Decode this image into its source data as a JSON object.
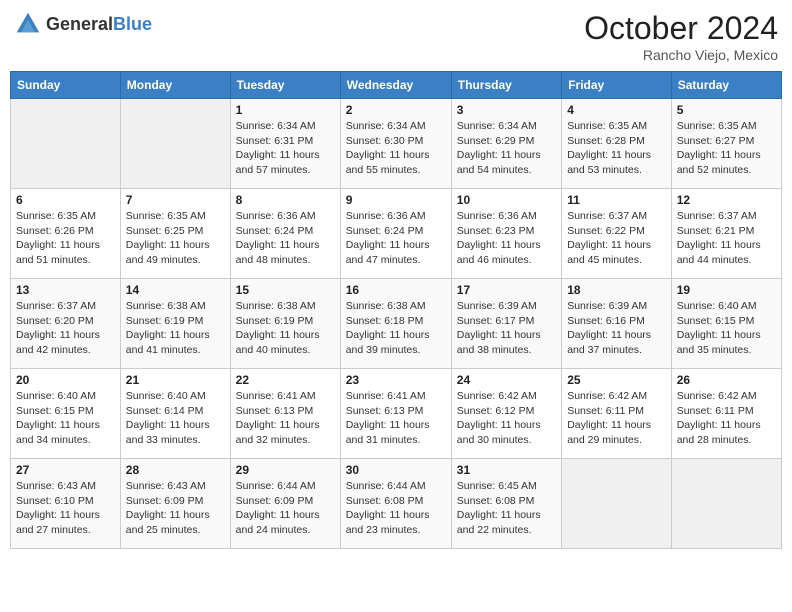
{
  "header": {
    "logo_general": "General",
    "logo_blue": "Blue",
    "month_year": "October 2024",
    "location": "Rancho Viejo, Mexico"
  },
  "days_of_week": [
    "Sunday",
    "Monday",
    "Tuesday",
    "Wednesday",
    "Thursday",
    "Friday",
    "Saturday"
  ],
  "weeks": [
    [
      {
        "day": "",
        "empty": true
      },
      {
        "day": "",
        "empty": true
      },
      {
        "day": "1",
        "sunrise": "6:34 AM",
        "sunset": "6:31 PM",
        "daylight": "11 hours and 57 minutes."
      },
      {
        "day": "2",
        "sunrise": "6:34 AM",
        "sunset": "6:30 PM",
        "daylight": "11 hours and 55 minutes."
      },
      {
        "day": "3",
        "sunrise": "6:34 AM",
        "sunset": "6:29 PM",
        "daylight": "11 hours and 54 minutes."
      },
      {
        "day": "4",
        "sunrise": "6:35 AM",
        "sunset": "6:28 PM",
        "daylight": "11 hours and 53 minutes."
      },
      {
        "day": "5",
        "sunrise": "6:35 AM",
        "sunset": "6:27 PM",
        "daylight": "11 hours and 52 minutes."
      }
    ],
    [
      {
        "day": "6",
        "sunrise": "6:35 AM",
        "sunset": "6:26 PM",
        "daylight": "11 hours and 51 minutes."
      },
      {
        "day": "7",
        "sunrise": "6:35 AM",
        "sunset": "6:25 PM",
        "daylight": "11 hours and 49 minutes."
      },
      {
        "day": "8",
        "sunrise": "6:36 AM",
        "sunset": "6:24 PM",
        "daylight": "11 hours and 48 minutes."
      },
      {
        "day": "9",
        "sunrise": "6:36 AM",
        "sunset": "6:24 PM",
        "daylight": "11 hours and 47 minutes."
      },
      {
        "day": "10",
        "sunrise": "6:36 AM",
        "sunset": "6:23 PM",
        "daylight": "11 hours and 46 minutes."
      },
      {
        "day": "11",
        "sunrise": "6:37 AM",
        "sunset": "6:22 PM",
        "daylight": "11 hours and 45 minutes."
      },
      {
        "day": "12",
        "sunrise": "6:37 AM",
        "sunset": "6:21 PM",
        "daylight": "11 hours and 44 minutes."
      }
    ],
    [
      {
        "day": "13",
        "sunrise": "6:37 AM",
        "sunset": "6:20 PM",
        "daylight": "11 hours and 42 minutes."
      },
      {
        "day": "14",
        "sunrise": "6:38 AM",
        "sunset": "6:19 PM",
        "daylight": "11 hours and 41 minutes."
      },
      {
        "day": "15",
        "sunrise": "6:38 AM",
        "sunset": "6:19 PM",
        "daylight": "11 hours and 40 minutes."
      },
      {
        "day": "16",
        "sunrise": "6:38 AM",
        "sunset": "6:18 PM",
        "daylight": "11 hours and 39 minutes."
      },
      {
        "day": "17",
        "sunrise": "6:39 AM",
        "sunset": "6:17 PM",
        "daylight": "11 hours and 38 minutes."
      },
      {
        "day": "18",
        "sunrise": "6:39 AM",
        "sunset": "6:16 PM",
        "daylight": "11 hours and 37 minutes."
      },
      {
        "day": "19",
        "sunrise": "6:40 AM",
        "sunset": "6:15 PM",
        "daylight": "11 hours and 35 minutes."
      }
    ],
    [
      {
        "day": "20",
        "sunrise": "6:40 AM",
        "sunset": "6:15 PM",
        "daylight": "11 hours and 34 minutes."
      },
      {
        "day": "21",
        "sunrise": "6:40 AM",
        "sunset": "6:14 PM",
        "daylight": "11 hours and 33 minutes."
      },
      {
        "day": "22",
        "sunrise": "6:41 AM",
        "sunset": "6:13 PM",
        "daylight": "11 hours and 32 minutes."
      },
      {
        "day": "23",
        "sunrise": "6:41 AM",
        "sunset": "6:13 PM",
        "daylight": "11 hours and 31 minutes."
      },
      {
        "day": "24",
        "sunrise": "6:42 AM",
        "sunset": "6:12 PM",
        "daylight": "11 hours and 30 minutes."
      },
      {
        "day": "25",
        "sunrise": "6:42 AM",
        "sunset": "6:11 PM",
        "daylight": "11 hours and 29 minutes."
      },
      {
        "day": "26",
        "sunrise": "6:42 AM",
        "sunset": "6:11 PM",
        "daylight": "11 hours and 28 minutes."
      }
    ],
    [
      {
        "day": "27",
        "sunrise": "6:43 AM",
        "sunset": "6:10 PM",
        "daylight": "11 hours and 27 minutes."
      },
      {
        "day": "28",
        "sunrise": "6:43 AM",
        "sunset": "6:09 PM",
        "daylight": "11 hours and 25 minutes."
      },
      {
        "day": "29",
        "sunrise": "6:44 AM",
        "sunset": "6:09 PM",
        "daylight": "11 hours and 24 minutes."
      },
      {
        "day": "30",
        "sunrise": "6:44 AM",
        "sunset": "6:08 PM",
        "daylight": "11 hours and 23 minutes."
      },
      {
        "day": "31",
        "sunrise": "6:45 AM",
        "sunset": "6:08 PM",
        "daylight": "11 hours and 22 minutes."
      },
      {
        "day": "",
        "empty": true
      },
      {
        "day": "",
        "empty": true
      }
    ]
  ]
}
